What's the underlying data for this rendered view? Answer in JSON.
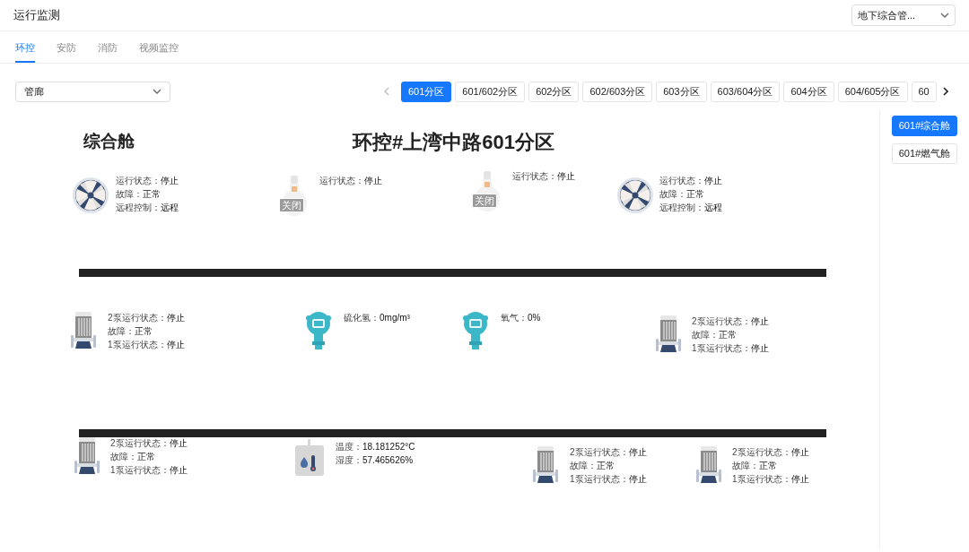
{
  "header": {
    "title": "运行监测",
    "site_select": "地下综合管..."
  },
  "tabs": [
    {
      "label": "环控",
      "selected": true
    },
    {
      "label": "安防",
      "selected": false
    },
    {
      "label": "消防",
      "selected": false
    },
    {
      "label": "视频监控",
      "selected": false
    }
  ],
  "area_select": "管廊",
  "partitions": [
    {
      "label": "601分区",
      "selected": true
    },
    {
      "label": "601/602分区",
      "selected": false
    },
    {
      "label": "602分区",
      "selected": false
    },
    {
      "label": "602/603分区",
      "selected": false
    },
    {
      "label": "603分区",
      "selected": false
    },
    {
      "label": "603/604分区",
      "selected": false
    },
    {
      "label": "604分区",
      "selected": false
    },
    {
      "label": "604/605分区",
      "selected": false
    },
    {
      "label": "60",
      "selected": false
    }
  ],
  "cabins": [
    {
      "label": "601#综合舱",
      "selected": true
    },
    {
      "label": "601#燃气舱",
      "selected": false
    }
  ],
  "diagram": {
    "cabin_title": "综合舱",
    "title": "环控#上湾中路601分区",
    "rows": [
      [
        {
          "kind": "fan",
          "lines": [
            {
              "label": "运行状态：",
              "value": "停止"
            },
            {
              "label": "故障：",
              "value": "正常"
            },
            {
              "label": "远程控制：",
              "value": "远程"
            }
          ]
        },
        {
          "kind": "valve",
          "badge": "关闭",
          "lines": [
            {
              "label": "运行状态：",
              "value": "停止"
            }
          ]
        },
        {
          "kind": "valve",
          "badge": "关闭",
          "lines": [
            {
              "label": "运行状态：",
              "value": "停止"
            }
          ]
        },
        {
          "kind": "fan",
          "lines": [
            {
              "label": "运行状态：",
              "value": "停止"
            },
            {
              "label": "故障：",
              "value": "正常"
            },
            {
              "label": "远程控制：",
              "value": "远程"
            }
          ]
        }
      ],
      [
        {
          "kind": "pump",
          "lines": [
            {
              "label": "2泵运行状态：",
              "value": "停止"
            },
            {
              "label": "故障：",
              "value": "正常"
            },
            {
              "label": "1泵运行状态：",
              "value": "停止"
            }
          ]
        },
        {
          "kind": "gas",
          "lines": [
            {
              "label": "硫化氢：",
              "value": "0mg/m³"
            }
          ]
        },
        {
          "kind": "gas",
          "lines": [
            {
              "label": "氧气：",
              "value": "0%"
            }
          ]
        },
        {
          "kind": "pump",
          "lines": [
            {
              "label": "2泵运行状态：",
              "value": "停止"
            },
            {
              "label": "故障：",
              "value": "正常"
            },
            {
              "label": "1泵运行状态：",
              "value": "停止"
            }
          ]
        }
      ],
      [
        {
          "kind": "pump",
          "lines": [
            {
              "label": "2泵运行状态：",
              "value": "停止"
            },
            {
              "label": "故障：",
              "value": "正常"
            },
            {
              "label": "1泵运行状态：",
              "value": "停止"
            }
          ]
        },
        {
          "kind": "thermo",
          "lines": [
            {
              "label": "温度：",
              "value": "18.181252°C"
            },
            {
              "label": "湿度：",
              "value": "57.465626%"
            }
          ]
        },
        {
          "kind": "pump",
          "lines": [
            {
              "label": "2泵运行状态：",
              "value": "停止"
            },
            {
              "label": "故障：",
              "value": "正常"
            },
            {
              "label": "1泵运行状态：",
              "value": "停止"
            }
          ]
        },
        {
          "kind": "pump",
          "lines": [
            {
              "label": "2泵运行状态：",
              "value": "停止"
            },
            {
              "label": "故障：",
              "value": "正常"
            },
            {
              "label": "1泵运行状态：",
              "value": "停止"
            }
          ]
        }
      ]
    ]
  }
}
